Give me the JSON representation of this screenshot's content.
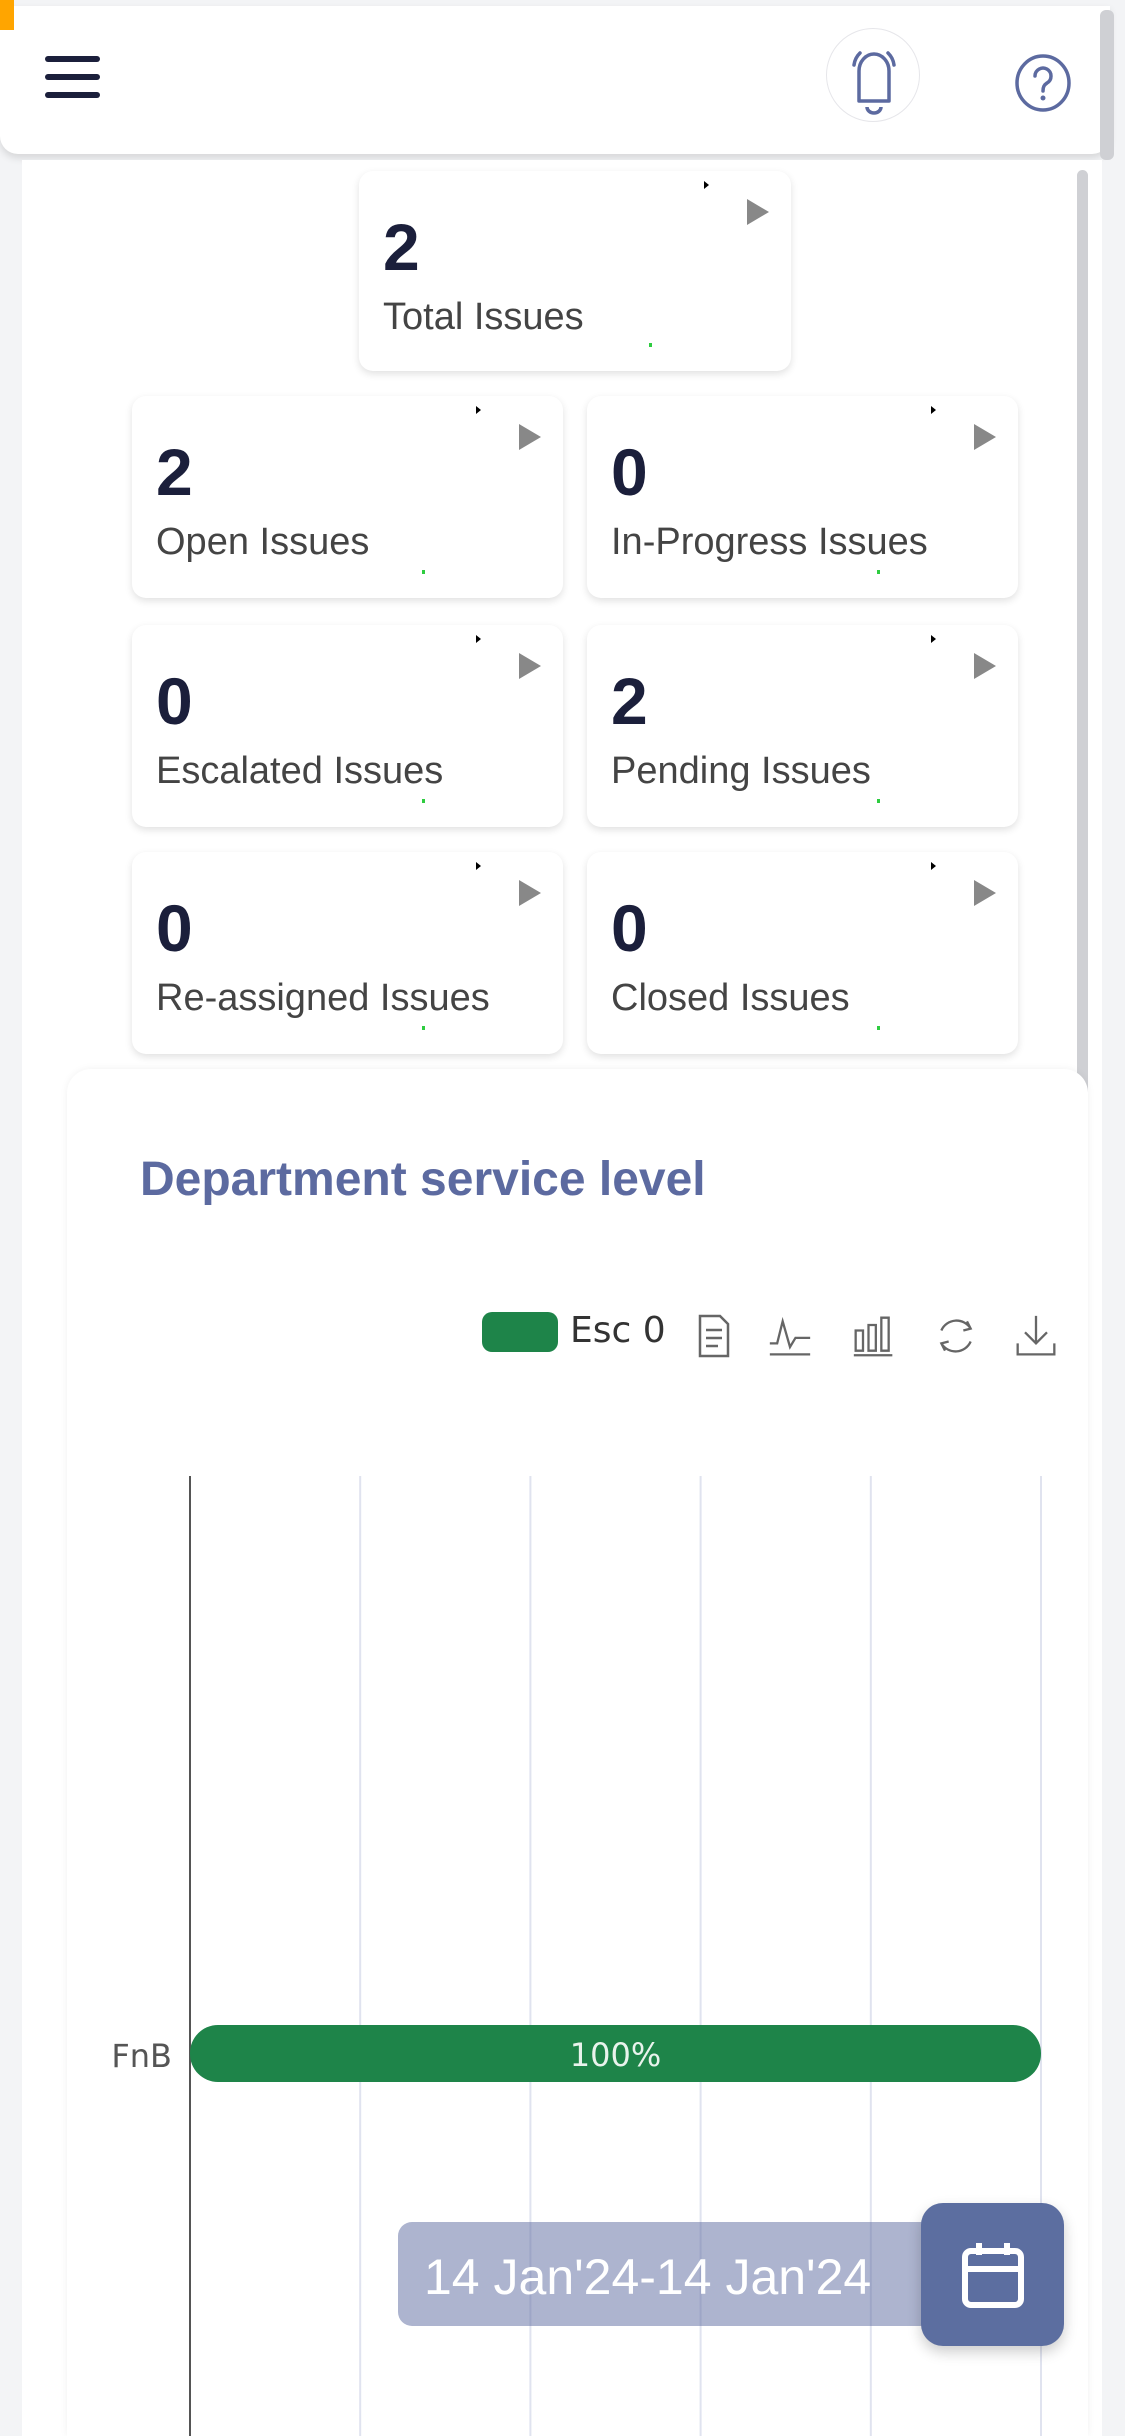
{
  "header": {
    "menu_icon": "hamburger-icon",
    "notification_icon": "bell-icon",
    "help_icon": "question-circle-icon"
  },
  "summary": {
    "total": {
      "value": "2",
      "label": "Total Issues"
    },
    "cards": [
      {
        "value": "2",
        "label": "Open Issues"
      },
      {
        "value": "0",
        "label": "In-Progress Issues"
      },
      {
        "value": "0",
        "label": "Escalated Issues"
      },
      {
        "value": "2",
        "label": "Pending Issues"
      },
      {
        "value": "0",
        "label": "Re-assigned Issues"
      },
      {
        "value": "0",
        "label": "Closed Issues"
      }
    ]
  },
  "chart_section": {
    "title": "Department service level",
    "toolbar": [
      "data-view-icon",
      "line-chart-icon",
      "bar-chart-icon",
      "restore-icon",
      "download-icon"
    ]
  },
  "chart_data": {
    "type": "bar",
    "orientation": "horizontal",
    "categories": [
      "FnB"
    ],
    "series": [
      {
        "name": "Esc 0",
        "values": [
          100
        ],
        "color": "#1e8449"
      }
    ],
    "data_labels": [
      "100%"
    ],
    "xlim": [
      0,
      100
    ],
    "grid": true,
    "legend": "top-right"
  },
  "date_filter": {
    "value": "14 Jan'24-14 Jan'24",
    "icon": "calendar-icon"
  },
  "colors": {
    "accent": "#5c6aa0",
    "bar": "#1e8449",
    "text_dark": "#1b1f3b"
  }
}
